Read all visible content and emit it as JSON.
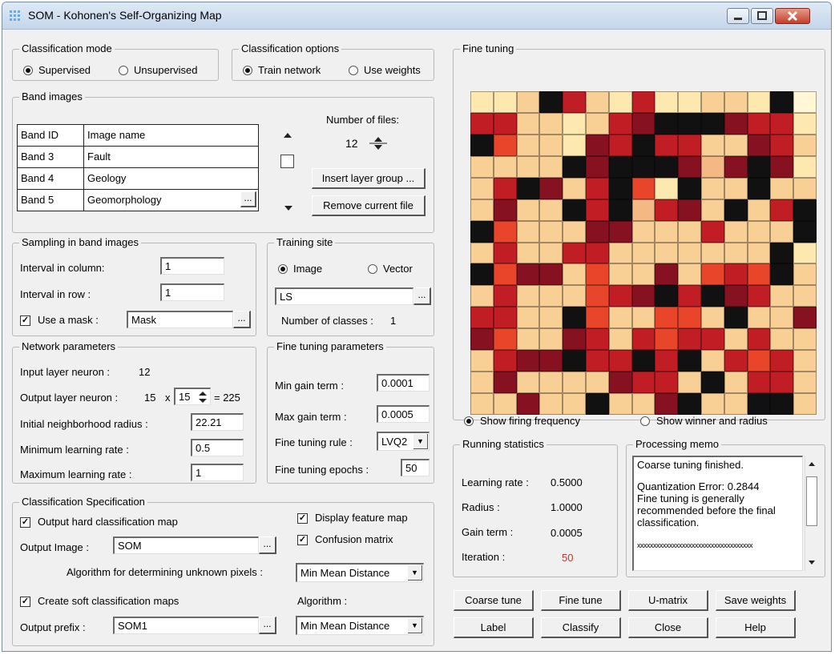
{
  "window": {
    "title": "SOM - Kohonen's Self-Organizing Map"
  },
  "classification_mode": {
    "legend": "Classification mode",
    "supervised": "Supervised",
    "unsupervised": "Unsupervised",
    "selected": "supervised"
  },
  "classification_options": {
    "legend": "Classification options",
    "train": "Train network",
    "weights": "Use weights",
    "selected": "train"
  },
  "band_images": {
    "legend": "Band images",
    "header": {
      "id": "Band ID",
      "name": "Image name"
    },
    "rows": [
      {
        "id": "Band 3",
        "name": "Fault"
      },
      {
        "id": "Band 4",
        "name": "Geology"
      },
      {
        "id": "Band 5",
        "name": "Geomorphology"
      }
    ],
    "files_label": "Number of files:",
    "files_value": "12",
    "insert_btn": "Insert layer group ...",
    "remove_btn": "Remove current file",
    "browse": "..."
  },
  "sampling": {
    "legend": "Sampling in band images",
    "col_label": "Interval in column:",
    "col_value": "1",
    "row_label": "Interval in row :",
    "row_value": "1",
    "mask_label": "Use a mask :",
    "mask_checked": true,
    "mask_value": "Mask",
    "browse": "..."
  },
  "training_site": {
    "legend": "Training site",
    "image": "Image",
    "vector": "Vector",
    "selected": "image",
    "value": "LS",
    "browse": "...",
    "classes_label": "Number of classes :",
    "classes_value": "1"
  },
  "network": {
    "legend": "Network parameters",
    "input_label": "Input layer neuron :",
    "input_value": "12",
    "output_label": "Output layer neuron :",
    "output_first": "15",
    "output_x": "x",
    "output_second": "15",
    "output_total": "= 225",
    "radius_label": "Initial neighborhood radius :",
    "radius_value": "22.21",
    "min_rate_label": "Minimum learning rate :",
    "min_rate_value": "0.5",
    "max_rate_label": "Maximum learning rate :",
    "max_rate_value": "1"
  },
  "fine_params": {
    "legend": "Fine tuning parameters",
    "min_gain_label": "Min gain term :",
    "min_gain_value": "0.0001",
    "max_gain_label": "Max gain term :",
    "max_gain_value": "0.0005",
    "rule_label": "Fine tuning rule :",
    "rule_value": "LVQ2",
    "epochs_label": "Fine tuning epochs :",
    "epochs_value": "50"
  },
  "class_spec": {
    "legend": "Classification Specification",
    "hard_label": "Output hard classification map",
    "hard_checked": true,
    "output_image_label": "Output Image :",
    "output_image_value": "SOM",
    "display_label": "Display feature map",
    "display_checked": true,
    "confusion_label": "Confusion matrix",
    "confusion_checked": true,
    "unknown_label": "Algorithm for determining unknown pixels :",
    "unknown_value": "Min Mean Distance",
    "soft_label": "Create soft classification maps",
    "soft_checked": true,
    "algorithm_label": "Algorithm :",
    "algorithm_value": "Min Mean Distance",
    "prefix_label": "Output prefix :",
    "prefix_value": "SOM1",
    "browse": "..."
  },
  "fine_tuning": {
    "legend": "Fine tuning",
    "show_freq": "Show firing frequency",
    "show_winner": "Show winner and radius",
    "selected": "freq",
    "palette": [
      "#ffffff",
      "#fff7d6",
      "#fde8b0",
      "#f8d095",
      "#f3b883",
      "#e8452a",
      "#c01e24",
      "#861221",
      "#111111"
    ],
    "grid": [
      [
        2,
        2,
        3,
        8,
        6,
        3,
        2,
        6,
        2,
        2,
        3,
        3,
        2,
        8,
        1
      ],
      [
        6,
        6,
        3,
        3,
        2,
        3,
        6,
        7,
        8,
        8,
        8,
        7,
        6,
        6,
        2
      ],
      [
        8,
        5,
        3,
        3,
        2,
        7,
        6,
        8,
        6,
        6,
        3,
        3,
        7,
        6,
        3
      ],
      [
        3,
        3,
        3,
        3,
        8,
        7,
        8,
        8,
        8,
        7,
        4,
        7,
        8,
        7,
        2
      ],
      [
        3,
        6,
        8,
        7,
        3,
        6,
        8,
        5,
        2,
        8,
        3,
        3,
        8,
        3,
        3
      ],
      [
        3,
        7,
        3,
        3,
        8,
        6,
        8,
        4,
        6,
        7,
        3,
        8,
        3,
        6,
        8
      ],
      [
        8,
        5,
        3,
        3,
        3,
        7,
        7,
        3,
        3,
        3,
        6,
        3,
        3,
        3,
        8
      ],
      [
        3,
        6,
        3,
        3,
        6,
        6,
        3,
        3,
        3,
        3,
        3,
        3,
        3,
        8,
        2
      ],
      [
        8,
        5,
        7,
        7,
        3,
        5,
        3,
        3,
        7,
        3,
        5,
        6,
        5,
        8,
        3
      ],
      [
        3,
        6,
        3,
        3,
        3,
        5,
        6,
        7,
        8,
        6,
        8,
        7,
        6,
        3,
        3
      ],
      [
        6,
        6,
        3,
        3,
        8,
        5,
        3,
        3,
        5,
        5,
        3,
        8,
        3,
        3,
        7
      ],
      [
        7,
        5,
        3,
        3,
        7,
        6,
        3,
        6,
        5,
        6,
        6,
        3,
        6,
        3,
        3
      ],
      [
        3,
        6,
        7,
        7,
        8,
        6,
        6,
        8,
        6,
        8,
        3,
        6,
        5,
        6,
        3
      ],
      [
        3,
        7,
        3,
        3,
        3,
        3,
        7,
        6,
        6,
        3,
        8,
        3,
        6,
        6,
        3
      ],
      [
        3,
        3,
        7,
        3,
        3,
        8,
        3,
        3,
        7,
        8,
        3,
        3,
        8,
        8,
        3
      ]
    ]
  },
  "running_stats": {
    "legend": "Running statistics",
    "rate_label": "Learning rate :",
    "rate_value": "0.5000",
    "radius_label": "Radius :",
    "radius_value": "1.0000",
    "gain_label": "Gain term :",
    "gain_value": "0.0005",
    "iter_label": "Iteration :",
    "iter_value": "50",
    "iter_color": "#c0392b"
  },
  "memo": {
    "legend": "Processing memo",
    "line1": "Coarse tuning finished.",
    "line2": "Quantization Error: 0.2844",
    "line3": "Fine tuning is generally recommended before the final classification.",
    "line4": "xxxxxxxxxxxxxxxxxxxxxxxxxxxxxxxxxxxx"
  },
  "buttons": {
    "coarse": "Coarse tune",
    "fine": "Fine tune",
    "umatrix": "U-matrix",
    "save": "Save weights",
    "label": "Label",
    "classify": "Classify",
    "close": "Close",
    "help": "Help"
  }
}
